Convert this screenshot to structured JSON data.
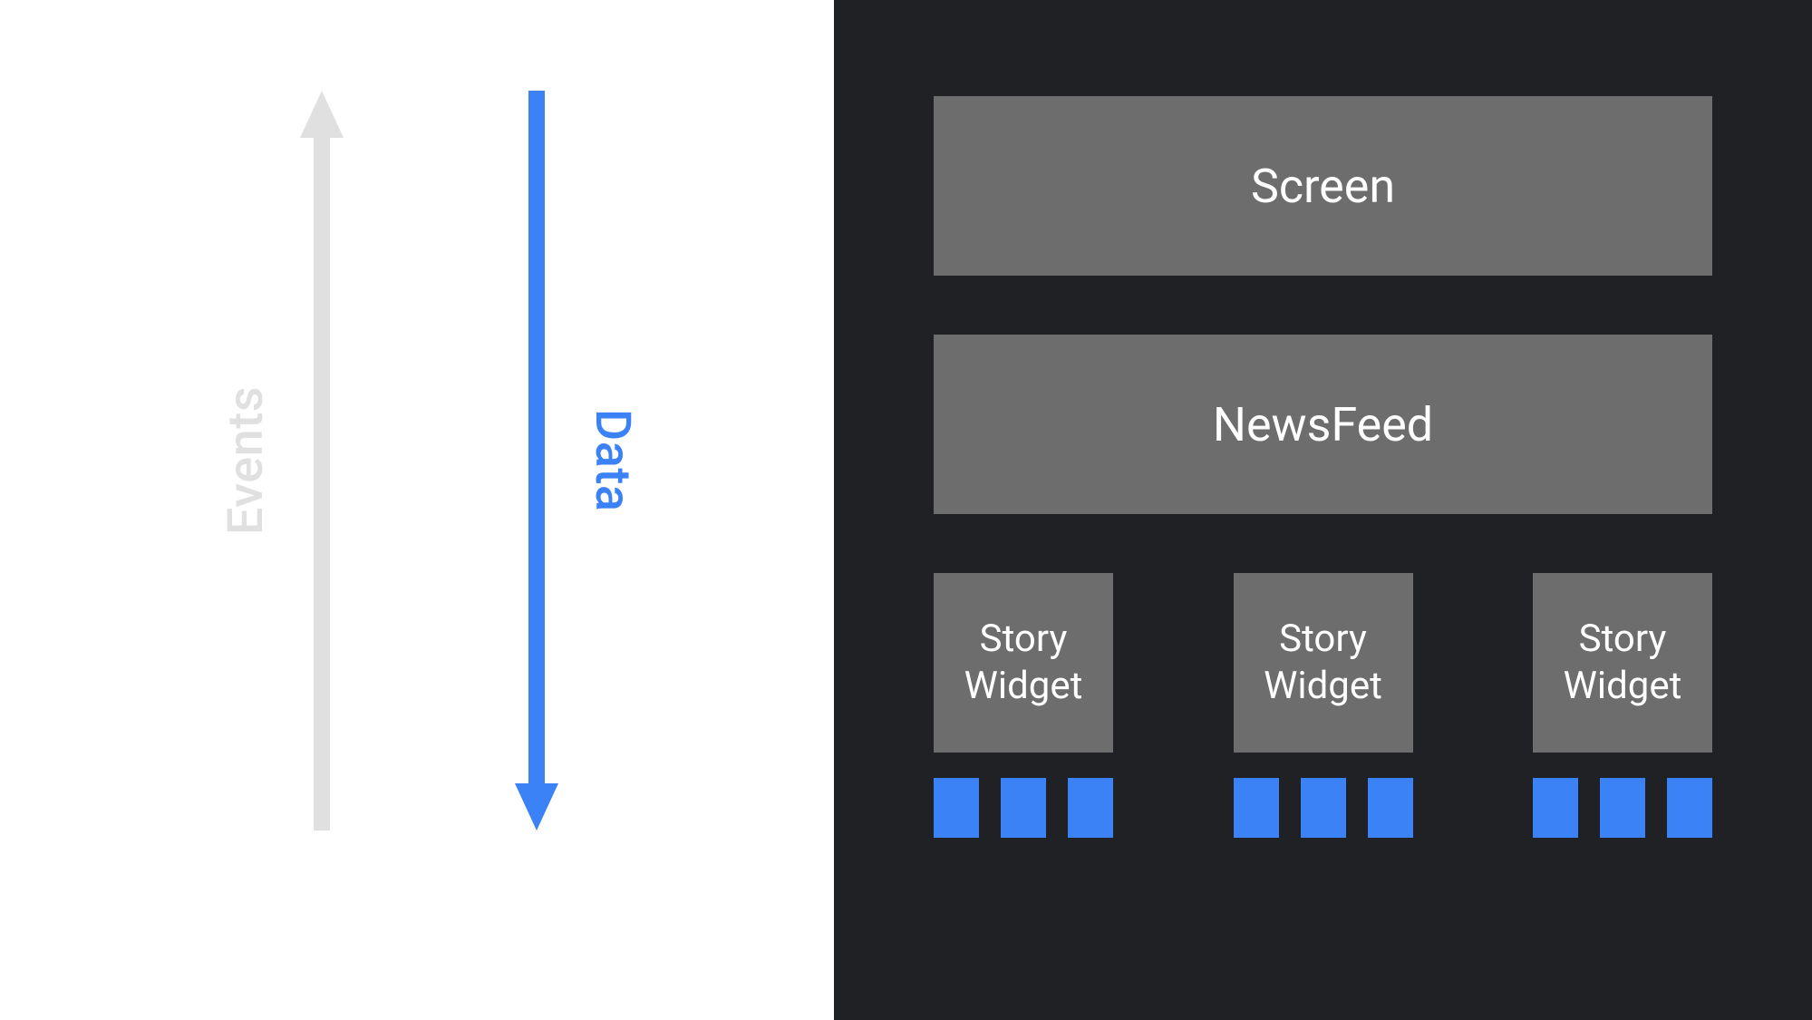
{
  "arrows": {
    "events": {
      "label": "Events",
      "direction": "up",
      "color": "#e0e0e0"
    },
    "data": {
      "label": "Data",
      "direction": "down",
      "color": "#3b82f6"
    }
  },
  "hierarchy": {
    "top": "Screen",
    "middle": "NewsFeed",
    "widgets": [
      "Story\nWidget",
      "Story\nWidget",
      "Story\nWidget"
    ],
    "chips_per_widget": 3
  },
  "colors": {
    "panel_dark": "#202124",
    "box_gray": "#6d6d6d",
    "accent_blue": "#3b82f6",
    "events_arrow": "#e0e0e0"
  }
}
